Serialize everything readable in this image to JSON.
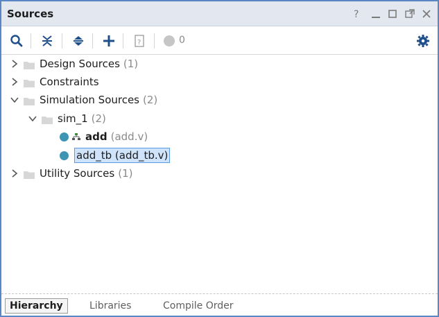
{
  "window": {
    "title": "Sources",
    "controls": [
      "help-icon",
      "minimize-icon",
      "maximize-icon",
      "restore-icon",
      "close-icon"
    ]
  },
  "toolbar": {
    "buttons": [
      "search-icon",
      "collapse-all-icon",
      "expand-all-icon",
      "add-icon",
      "help-icon",
      "status-icon"
    ],
    "status_count": "0"
  },
  "tree": [
    {
      "label": "Design Sources",
      "count": "(1)",
      "expanded": false
    },
    {
      "label": "Constraints",
      "count": "",
      "expanded": false
    },
    {
      "label": "Simulation Sources",
      "count": "(2)",
      "expanded": true,
      "children": [
        {
          "label": "sim_1",
          "count": "(2)",
          "expanded": true,
          "children": [
            {
              "label": "add",
              "file": "(add.v)",
              "bold": true
            },
            {
              "label": "add_tb (add_tb.v)",
              "selected": true
            }
          ]
        }
      ]
    },
    {
      "label": "Utility Sources",
      "count": "(1)",
      "expanded": false
    }
  ],
  "tabs": [
    "Hierarchy",
    "Libraries",
    "Compile Order"
  ],
  "colors": {
    "accent": "#5b86c5",
    "titlebar": "#e3e8f0",
    "dot": "#3e94b3",
    "selection": "#cfe3fb"
  }
}
